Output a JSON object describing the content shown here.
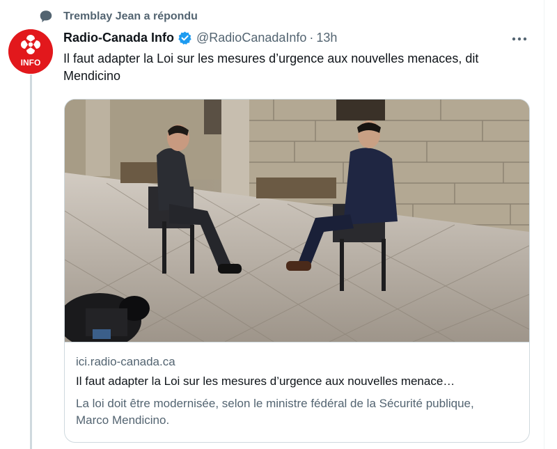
{
  "social_context": {
    "icon": "speech-bubble-icon",
    "text": "Tremblay Jean a répondu"
  },
  "tweet": {
    "avatar": {
      "text": "INFO",
      "brand_color": "#e2181c"
    },
    "author_name": "Radio-Canada Info",
    "verified_icon": "verified-badge-icon",
    "verified_color": "#1d9bf0",
    "handle": "@RadioCanadaInfo",
    "separator": "·",
    "time": "13h",
    "more_icon": "more-horizontal-icon",
    "text": "Il faut adapter la Loi sur les mesures d’urgence aux nouvelles menaces, dit Mendicino"
  },
  "card": {
    "image_description_icon": "interview-photo",
    "domain": "ici.radio-canada.ca",
    "title": "Il faut adapter la Loi sur les mesures d’urgence aux nouvelles menace…",
    "description": "La loi doit être modernisée, selon le ministre fédéral de la Sécurité publique, Marco Mendicino."
  },
  "colors": {
    "text_primary": "#0f1419",
    "text_secondary": "#536471",
    "border": "#cfd9de"
  }
}
